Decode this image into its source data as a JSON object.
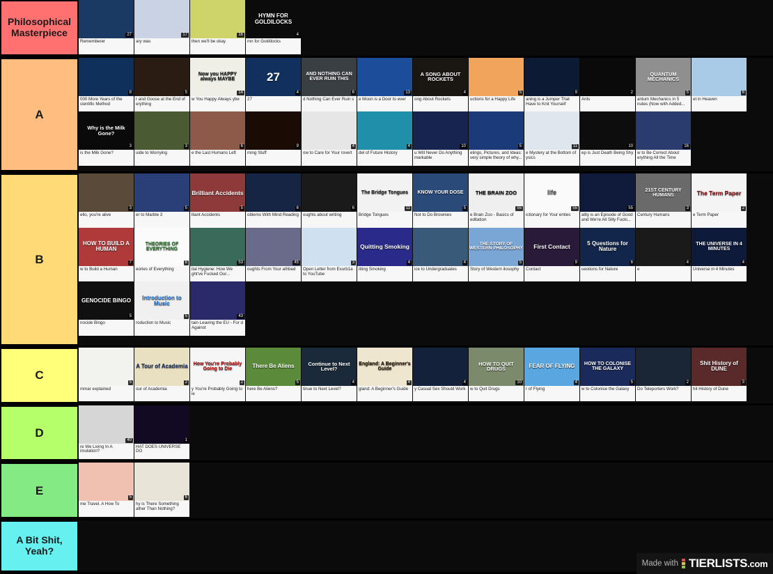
{
  "app": {
    "watermark_prefix": "Made with",
    "watermark_brand": "TIERLISTS",
    "watermark_tld": ".com",
    "watermark_dot_colors": [
      "#e24a3b",
      "#e8c33a",
      "#8cc63f"
    ]
  },
  "tiers": [
    {
      "label": "Philosophical Masterpiece",
      "color": "#ff7171",
      "items": [
        {
          "title": "Rememberer",
          "thumb_text": "",
          "duration": "27",
          "bg": "#1b3a63",
          "fg": "#ffffff",
          "fs": 9
        },
        {
          "title": "ary was",
          "thumb_text": "",
          "duration": "17",
          "bg": "#c9d3e4",
          "fg": "#32415c",
          "fs": 9
        },
        {
          "title": "then we'll be okay",
          "thumb_text": "",
          "duration": "16",
          "bg": "#cfd46a",
          "fg": "#4a4a20",
          "fs": 9
        },
        {
          "title": "mn for Goldilocks",
          "thumb_text": "HYMN FOR GOLDILOCKS",
          "duration": "4",
          "bg": "#0b0b0b",
          "fg": "#ffffff",
          "fs": 8
        }
      ]
    },
    {
      "label": "A",
      "color": "#ffbd80",
      "items": [
        {
          "title": "000 More Years of the cientific Method",
          "thumb_text": "",
          "duration": "8",
          "bg": "#10305c",
          "fg": "#ffffff",
          "fs": 8
        },
        {
          "title": "r and Goose at the End of erything",
          "thumb_text": "",
          "duration": "5",
          "bg": "#2a1c12",
          "fg": "#ffffff",
          "fs": 8
        },
        {
          "title": "w You Happy Always ybe",
          "thumb_text": "Now you HAPPY always MAYBE",
          "duration": "14",
          "bg": "#efefe8",
          "fg": "#1a1a1a",
          "fs": 7
        },
        {
          "title": "27",
          "thumb_text": "27",
          "duration": "4",
          "bg": "#11305e",
          "fg": "#ffffff",
          "fs": 17
        },
        {
          "title": "d Nothing Can Ever Ruin s",
          "thumb_text": "AND NOTHING CAN EVER RUIN THIS",
          "duration": "6",
          "bg": "#3a3f44",
          "fg": "#ffffff",
          "fs": 7
        },
        {
          "title": "e Moon is a Door to ever",
          "thumb_text": "",
          "duration": "13",
          "bg": "#1b4d9b",
          "fg": "#ffffff",
          "fs": 8
        },
        {
          "title": "ong About Rockets",
          "thumb_text": "A SONG ABOUT ROCKETS",
          "duration": "4",
          "bg": "#1a1612",
          "fg": "#ffffff",
          "fs": 7.5
        },
        {
          "title": "uctions for a Happy Life",
          "thumb_text": "",
          "duration": "5",
          "bg": "#f0a45c",
          "fg": "#111111",
          "fs": 8
        },
        {
          "title": "aning is a Jumper That Have to Knit Yourself",
          "thumb_text": "",
          "duration": "9",
          "bg": "#0d1a33",
          "fg": "#ffffff",
          "fs": 8
        },
        {
          "title": "Ants",
          "thumb_text": "",
          "duration": "2",
          "bg": "#0a0a0a",
          "fg": "#ffffff",
          "fs": 8
        },
        {
          "title": "antum Mechanics in 5 nutes (Now with Added...",
          "thumb_text": "QUANTUM MECHANICS",
          "duration": "5",
          "bg": "#8f8f8f",
          "fg": "#ffffff",
          "fs": 7.5
        },
        {
          "title": "et in Heaven",
          "thumb_text": "",
          "duration": "6",
          "bg": "#a9cbe8",
          "fg": "#11223a",
          "fs": 8
        },
        {
          "title": "is the Milk Gone?",
          "thumb_text": "Why is the Milk Gone?",
          "duration": "3",
          "bg": "#0a0a0a",
          "fg": "#ffffff",
          "fs": 7.5
        },
        {
          "title": "uide to Worrying",
          "thumb_text": "",
          "duration": "3",
          "bg": "#4a5a33",
          "fg": "#ffffff",
          "fs": 8
        },
        {
          "title": "e the Last Humans Left",
          "thumb_text": "",
          "duration": "6",
          "bg": "#8d5a4a",
          "fg": "#ffffff",
          "fs": 8
        },
        {
          "title": "ming Stuff",
          "thumb_text": "",
          "duration": "9",
          "bg": "#1a0b05",
          "fg": "#ffd48a",
          "fs": 8
        },
        {
          "title": "ow to Care for Your rovert",
          "thumb_text": "",
          "duration": "4",
          "bg": "#e6e6e6",
          "fg": "#3a3a3a",
          "fs": 8
        },
        {
          "title": "del of Future History",
          "thumb_text": "",
          "duration": "4",
          "bg": "#1f8faa",
          "fg": "#ffffff",
          "fs": 8
        },
        {
          "title": "u Will Never Do Anything markable",
          "thumb_text": "",
          "duration": "10",
          "bg": "#17244f",
          "fg": "#ffffff",
          "fs": 8
        },
        {
          "title": "elings, Pictures, and Ideas: very simple theory of why...",
          "thumb_text": "",
          "duration": "5",
          "bg": "#1a3a7a",
          "fg": "#ffffff",
          "fs": 8
        },
        {
          "title": "e Mystery at the Bottom of ysics",
          "thumb_text": "",
          "duration": "11",
          "bg": "#dfe6ee",
          "fg": "#1b3560",
          "fs": 8
        },
        {
          "title": "ep is Just Death Being Shy",
          "thumb_text": "",
          "duration": "10",
          "bg": "#0d0d0d",
          "fg": "#ffffff",
          "fs": 8
        },
        {
          "title": "w to Be Correct About erything All the Time",
          "thumb_text": "",
          "duration": "16",
          "bg": "#2a3b6e",
          "fg": "#ffe680",
          "fs": 8
        }
      ]
    },
    {
      "label": "B",
      "color": "#ffda77",
      "items": [
        {
          "title": "ello, you're alive",
          "thumb_text": "",
          "duration": "3",
          "bg": "#5a4a3a",
          "fg": "#ffffff",
          "fs": 8
        },
        {
          "title": "er to Marble 3",
          "thumb_text": "",
          "duration": "5",
          "bg": "#2a3f78",
          "fg": "#ffffff",
          "fs": 8
        },
        {
          "title": "lliant Accidents",
          "thumb_text": "Brilliant Accidents",
          "duration": "5",
          "bg": "#8f3a3a",
          "fg": "#ffffff",
          "fs": 8.5
        },
        {
          "title": "oblems With Mind Reading",
          "thumb_text": "",
          "duration": "6",
          "bg": "#172544",
          "fg": "#ffffff",
          "fs": 8
        },
        {
          "title": "oughts about writing",
          "thumb_text": "",
          "duration": "6",
          "bg": "#1a1a1a",
          "fg": "#dddddd",
          "fs": 8
        },
        {
          "title": "Bridge Tongues",
          "thumb_text": "The Bridge Tongues",
          "duration": "11",
          "bg": "#f2f2f2",
          "fg": "#222222",
          "fs": 7
        },
        {
          "title": "Not to Do Brownies",
          "thumb_text": "KNOW YOUR DOSE",
          "duration": "5",
          "bg": "#2a4a7a",
          "fg": "#ffffff",
          "fs": 7
        },
        {
          "title": "e Brain Zoo - Basics of editation",
          "thumb_text": "THE BRAIN ZOO",
          "duration": "55",
          "bg": "#efefef",
          "fg": "#111111",
          "fs": 7.5
        },
        {
          "title": "ictionary for Your enties",
          "thumb_text": "life",
          "duration": "55",
          "bg": "#fafafa",
          "fg": "#555555",
          "fs": 9
        },
        {
          "title": "ality is an Episode of Good and We're All Silly Fucki...",
          "thumb_text": "",
          "duration": "55",
          "bg": "#101a3a",
          "fg": "#ffffff",
          "fs": 8
        },
        {
          "title": "Century Humans",
          "thumb_text": "21ST CENTURY HUMANS",
          "duration": "3",
          "bg": "#6a6a6a",
          "fg": "#ffffff",
          "fs": 7
        },
        {
          "title": "e Term Paper",
          "thumb_text": "The Term Paper",
          "duration": "2",
          "bg": "#f4f4f4",
          "fg": "#8a1111",
          "fs": 8.5
        },
        {
          "title": "w to Build a Human",
          "thumb_text": "HOW TO BUILD A HUMAN",
          "duration": "7",
          "bg": "#b03a3a",
          "fg": "#ffffff",
          "fs": 8
        },
        {
          "title": "eories of Everything",
          "thumb_text": "THEORIES OF EVERYTHING",
          "duration": "8",
          "bg": "#fbfbfb",
          "fg": "#2a7a2a",
          "fs": 7
        },
        {
          "title": "ital Hygiene: How We ght've Fucked Our...",
          "thumb_text": "",
          "duration": "53",
          "bg": "#3a6a5a",
          "fg": "#ffffff",
          "fs": 8
        },
        {
          "title": "oughts From Your athbed",
          "thumb_text": "",
          "duration": "45",
          "bg": "#6a6a8a",
          "fg": "#ffffff",
          "fs": 8
        },
        {
          "title": "Open Letter from Exurb1a to YouTube",
          "thumb_text": "",
          "duration": "3",
          "bg": "#cfe0f0",
          "fg": "#223344",
          "fs": 8
        },
        {
          "title": "itting Smoking",
          "thumb_text": "Quitting Smoking",
          "duration": "4",
          "bg": "#2a2a8a",
          "fg": "#ffffff",
          "fs": 8.5
        },
        {
          "title": "ice to Undergraduates",
          "thumb_text": "",
          "duration": "4",
          "bg": "#3a5a7a",
          "fg": "#ffffff",
          "fs": 8
        },
        {
          "title": "Story of Western ilosophy",
          "thumb_text": "THE STORY OF WESTERN PHILOSOPHY",
          "duration": "5",
          "bg": "#7aa6d6",
          "fg": "#ffffff",
          "fs": 6.5
        },
        {
          "title": "Contact",
          "thumb_text": "First Contact",
          "duration": "9",
          "bg": "#2a1a3a",
          "fg": "#ffffff",
          "fs": 8.5
        },
        {
          "title": "uestions for Nature",
          "thumb_text": "5 Questions for Nature",
          "duration": "6",
          "bg": "#12254a",
          "fg": "#ffffff",
          "fs": 8
        },
        {
          "title": "e",
          "thumb_text": "",
          "duration": "4",
          "bg": "#1a1a1a",
          "fg": "#ffffff",
          "fs": 8
        },
        {
          "title": "Universe in 4 Minutes",
          "thumb_text": "THE UNIVERSE IN 4 MINUTES",
          "duration": "4",
          "bg": "#0d1a3a",
          "fg": "#ffffff",
          "fs": 7
        },
        {
          "title": "nocide Bingo",
          "thumb_text": "GENOCIDE BINGO",
          "duration": "5",
          "bg": "#101010",
          "fg": "#ffffff",
          "fs": 8
        },
        {
          "title": "roduction to Music",
          "thumb_text": "Introduction to Music",
          "duration": "5",
          "bg": "#f0f0f0",
          "fg": "#2a7ad6",
          "fs": 8
        },
        {
          "title": "tain Leaving the EU - For d Against",
          "thumb_text": "",
          "duration": "43",
          "bg": "#2a2a6a",
          "fg": "#ffffff",
          "fs": 8
        }
      ]
    },
    {
      "label": "C",
      "color": "#ffff7a",
      "items": [
        {
          "title": "mmar explained",
          "thumb_text": "",
          "duration": "5",
          "bg": "#f2f2ee",
          "fg": "#222222",
          "fs": 8
        },
        {
          "title": "our of Academia",
          "thumb_text": "A Tour of Academia",
          "duration": "2",
          "bg": "#e8e0c0",
          "fg": "#223366",
          "fs": 8
        },
        {
          "title": "y You're Probably Going to ie",
          "thumb_text": "How You're Probably Going to Die",
          "duration": "2",
          "bg": "#f6f6f6",
          "fg": "#aa1111",
          "fs": 7
        },
        {
          "title": "here Be Aliens?",
          "thumb_text": "There Be Aliens",
          "duration": "5",
          "bg": "#5a8a3a",
          "fg": "#ffffff",
          "fs": 8
        },
        {
          "title": "tinue to Next Level?",
          "thumb_text": "Continue to Next Level?",
          "duration": "4",
          "bg": "#1a2a3a",
          "fg": "#ffffff",
          "fs": 7.5
        },
        {
          "title": "gland: A Beginner's Guide",
          "thumb_text": "England: A Beginner's Guide",
          "duration": "4",
          "bg": "#efe6cf",
          "fg": "#221100",
          "fs": 7
        },
        {
          "title": "y Casual Sex Should Work",
          "thumb_text": "",
          "duration": "4",
          "bg": "#14213a",
          "fg": "#ffffff",
          "fs": 8
        },
        {
          "title": "w to Quit Drugs",
          "thumb_text": "HOW TO QUIT DRUGS",
          "duration": "10",
          "bg": "#7a8a6a",
          "fg": "#ffffff",
          "fs": 7.5
        },
        {
          "title": "r of Flying",
          "thumb_text": "FEAR OF FLYING",
          "duration": "4",
          "bg": "#5aa6e0",
          "fg": "#ffffff",
          "fs": 8
        },
        {
          "title": "w to Colonise the Galaxy",
          "thumb_text": "HOW TO COLONISE THE GALAXY",
          "duration": "5",
          "bg": "#1a2a5a",
          "fg": "#ffffff",
          "fs": 7
        },
        {
          "title": "Do Teleporters Work?",
          "thumb_text": "",
          "duration": "2",
          "bg": "#1a2636",
          "fg": "#ffffff",
          "fs": 8
        },
        {
          "title": "hit History of Dune",
          "thumb_text": "Shit History of DUNE",
          "duration": "3",
          "bg": "#5a2a2a",
          "fg": "#ffffff",
          "fs": 8
        }
      ]
    },
    {
      "label": "D",
      "color": "#b4ff6a",
      "items": [
        {
          "title": "re We Living In A imulation?",
          "thumb_text": "",
          "duration": "40",
          "bg": "#d6d6d6",
          "fg": "#222222",
          "fs": 8
        },
        {
          "title": "HAT DOES UNIVERSE DO",
          "thumb_text": "",
          "duration": "1",
          "bg": "#120a22",
          "fg": "#ffffff",
          "fs": 8
        }
      ]
    },
    {
      "label": "E",
      "color": "#84ea84",
      "items": [
        {
          "title": "me Travel. A How To",
          "thumb_text": "",
          "duration": "5",
          "bg": "#f0c0b0",
          "fg": "#333333",
          "fs": 8
        },
        {
          "title": "hy is There Something ather Than Nothing?",
          "thumb_text": "",
          "duration": "6",
          "bg": "#e8e4d8",
          "fg": "#333333",
          "fs": 8
        }
      ]
    },
    {
      "label": "A Bit Shit, Yeah?",
      "color": "#66f0f0",
      "items": []
    }
  ]
}
